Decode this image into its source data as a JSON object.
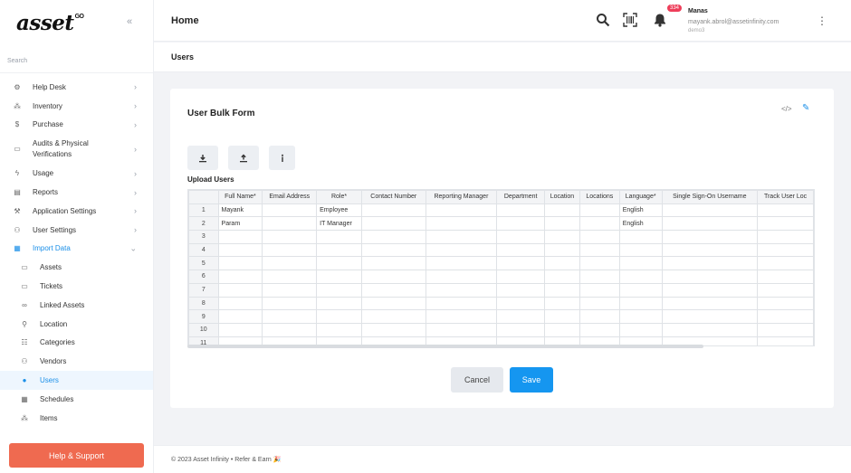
{
  "brand": {
    "logo_text": "asset",
    "logo_sup": "GO"
  },
  "sidebar": {
    "collapse_icon": "«",
    "search_placeholder": "Search",
    "items": [
      {
        "label": "Help Desk",
        "icon": "⚙"
      },
      {
        "label": "Inventory",
        "icon": "⁂"
      },
      {
        "label": "Purchase",
        "icon": "$"
      },
      {
        "label": "Audits & Physical Verifications",
        "icon": "▭"
      },
      {
        "label": "Usage",
        "icon": "ϟ"
      },
      {
        "label": "Reports",
        "icon": "▤"
      },
      {
        "label": "Application Settings",
        "icon": "⚒"
      },
      {
        "label": "User Settings",
        "icon": "⚇"
      },
      {
        "label": "Import Data",
        "icon": "▦"
      }
    ],
    "sub_items": [
      {
        "label": "Assets",
        "icon": "▭"
      },
      {
        "label": "Tickets",
        "icon": "▭"
      },
      {
        "label": "Linked Assets",
        "icon": "∞"
      },
      {
        "label": "Location",
        "icon": "⚲"
      },
      {
        "label": "Categories",
        "icon": "☷"
      },
      {
        "label": "Vendors",
        "icon": "⚇"
      },
      {
        "label": "Users",
        "icon": "●"
      },
      {
        "label": "Schedules",
        "icon": "▦"
      },
      {
        "label": "Items",
        "icon": "⁂"
      }
    ],
    "help_button": "Help & Support"
  },
  "header": {
    "title": "Home",
    "notification_count": "334",
    "user_name": "Manas",
    "user_email": "mayank.abrol@assetinfinity.com",
    "user_org": "demo3"
  },
  "subheader": {
    "title": "Users"
  },
  "form": {
    "title": "User Bulk Form",
    "upload_label": "Upload Users",
    "cancel_label": "Cancel",
    "save_label": "Save",
    "grid": {
      "columns": [
        "Full Name*",
        "Email Address",
        "Role*",
        "Contact Number",
        "Reporting Manager",
        "Department",
        "Location",
        "Locations",
        "Language*",
        "Single Sign-On Username",
        "Track User Loc"
      ],
      "row_numbers": [
        "1",
        "2",
        "3",
        "4",
        "5",
        "6",
        "7",
        "8",
        "9",
        "10",
        "11"
      ],
      "rows": [
        [
          "Mayank",
          "",
          "Employee",
          "",
          "",
          "",
          "",
          "",
          "English",
          "",
          ""
        ],
        [
          "Param",
          "",
          "IT Manager",
          "",
          "",
          "",
          "",
          "",
          "English",
          "",
          ""
        ]
      ]
    }
  },
  "footer": {
    "text": "© 2023  Asset Infinity • Refer & Earn 🎉"
  },
  "colors": {
    "accent": "#1a8fe8",
    "help": "#ef6a50",
    "badge": "#ee3e5a",
    "save": "#1596f0"
  }
}
